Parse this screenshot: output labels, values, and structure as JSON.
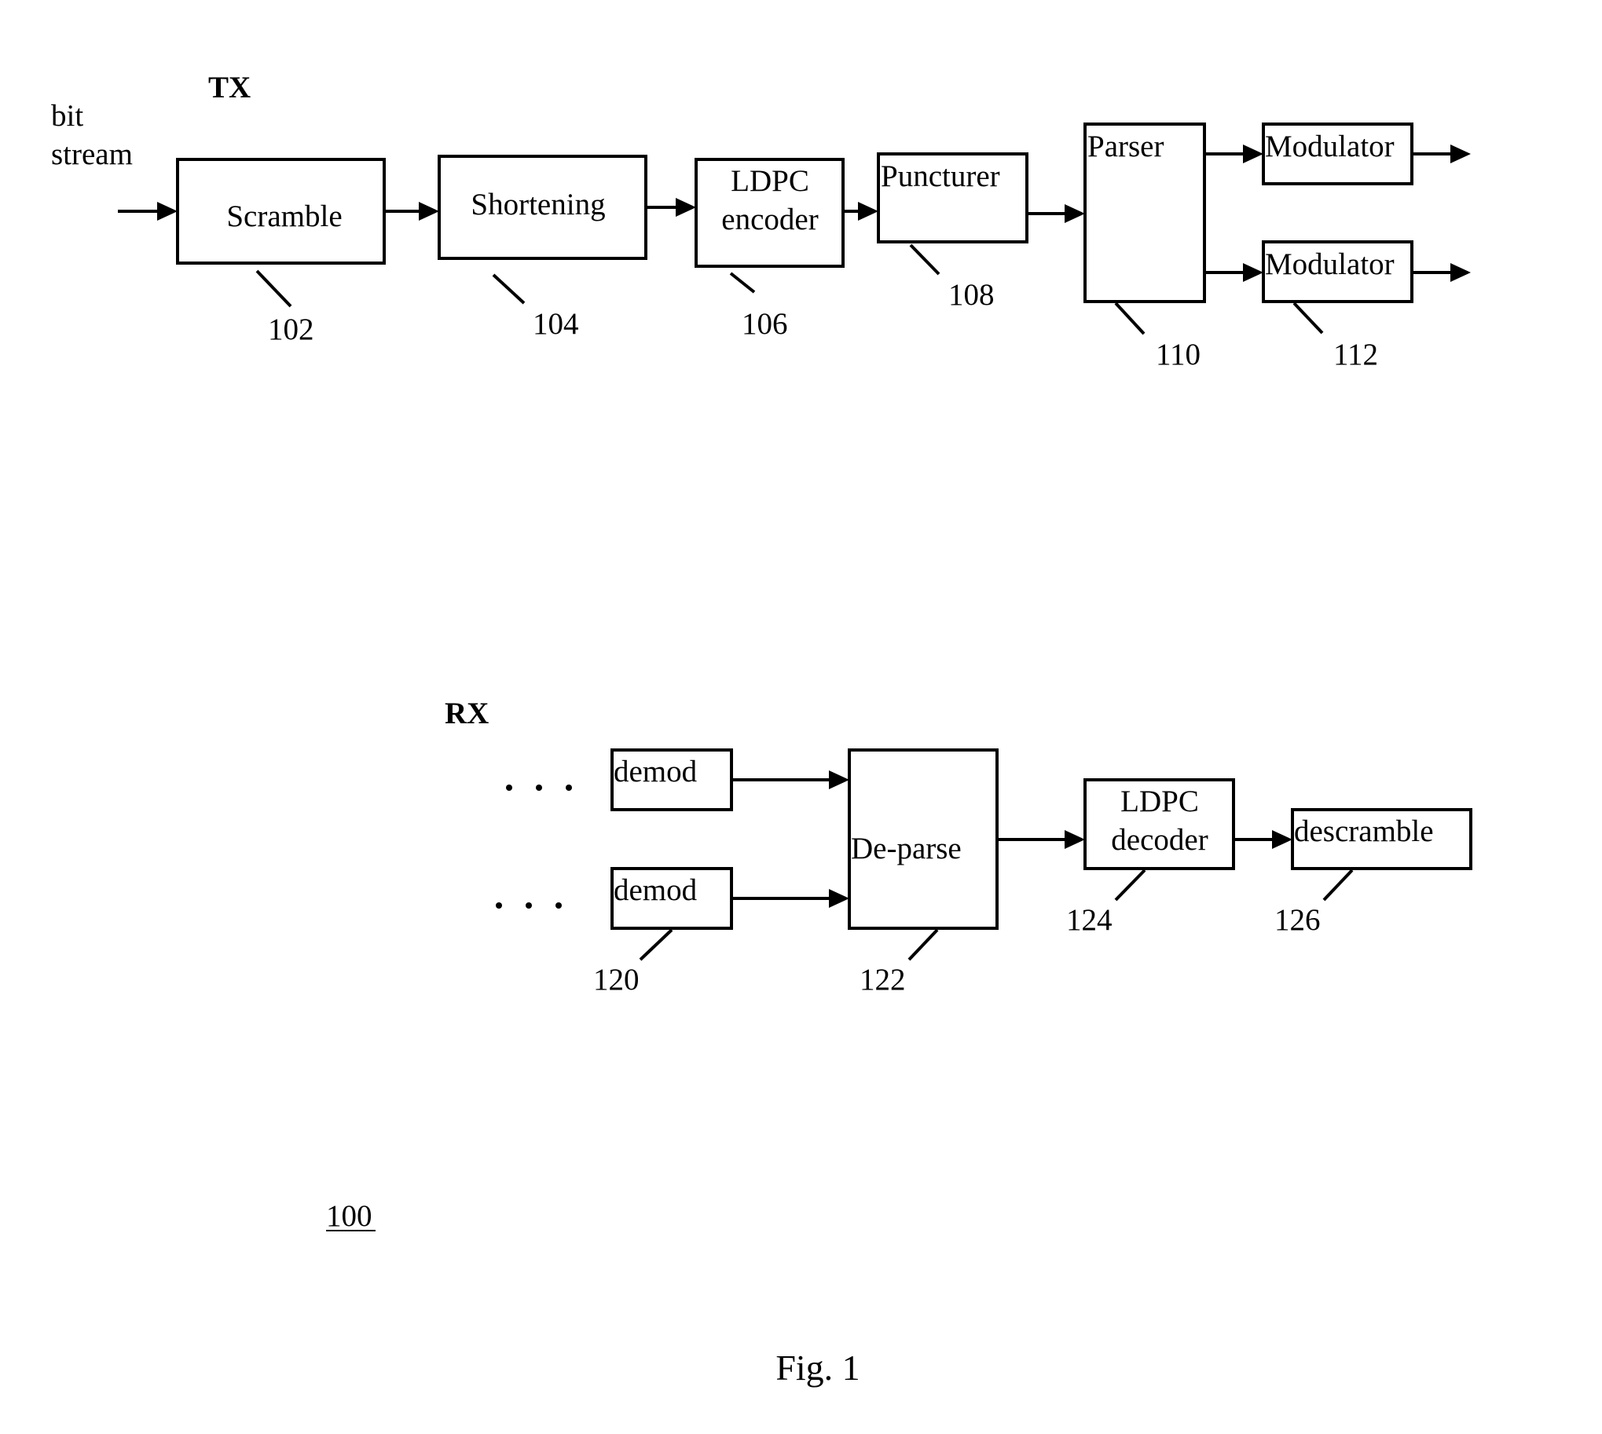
{
  "figure": {
    "caption": "Fig. 1",
    "reference": "100"
  },
  "tx": {
    "title": "TX",
    "input_label_line1": "bit",
    "input_label_line2": "stream",
    "blocks": [
      {
        "id": "scramble",
        "label": "Scramble",
        "ref": "102"
      },
      {
        "id": "shortening",
        "label": "Shortening",
        "ref": "104"
      },
      {
        "id": "ldpc-encoder",
        "label_line1": "LDPC",
        "label_line2": "encoder",
        "ref": "106"
      },
      {
        "id": "puncturer",
        "label": "Puncturer",
        "ref": "108"
      },
      {
        "id": "parser",
        "label": "Parser",
        "ref": "110"
      },
      {
        "id": "modulator-1",
        "label": "Modulator"
      },
      {
        "id": "modulator-2",
        "label": "Modulator",
        "ref": "112"
      }
    ]
  },
  "rx": {
    "title": "RX",
    "ellipsis": ". . .",
    "blocks": [
      {
        "id": "demod-1",
        "label": "demod"
      },
      {
        "id": "demod-2",
        "label": "demod",
        "ref": "120"
      },
      {
        "id": "de-parse",
        "label": "De-parse",
        "ref": "122"
      },
      {
        "id": "ldpc-decoder",
        "label_line1": "LDPC",
        "label_line2": "decoder",
        "ref": "124"
      },
      {
        "id": "descramble",
        "label": "descramble",
        "ref": "126"
      }
    ]
  }
}
